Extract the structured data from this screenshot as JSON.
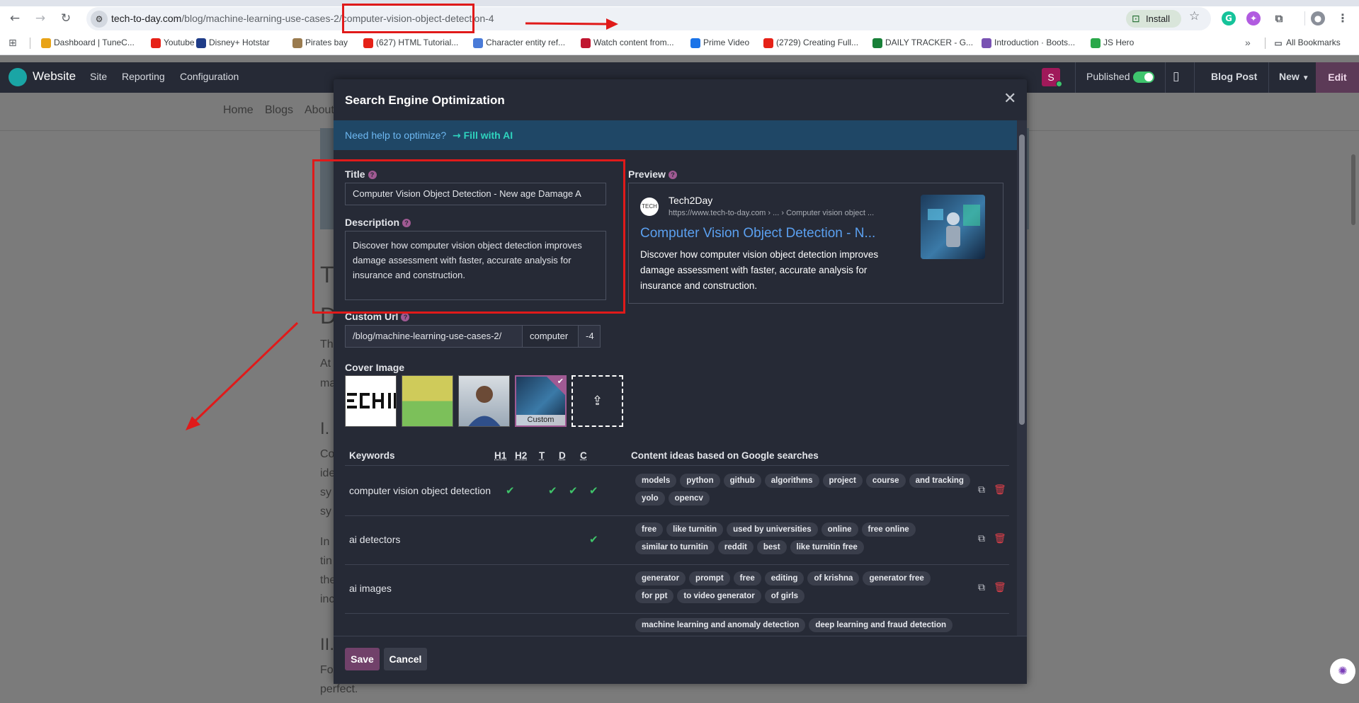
{
  "browser": {
    "url_domain": "tech-to-day.com",
    "url_path": "/blog/machine-learning-use-cases-2/computer-vision-object-detection-4",
    "install_label": "Install",
    "bookmarks": [
      {
        "label": "Dashboard | TuneC...",
        "color": "#e8a317"
      },
      {
        "label": "Youtube",
        "color": "#e62117"
      },
      {
        "label": "Disney+ Hotstar",
        "color": "#1f3c88"
      },
      {
        "label": "Pirates bay",
        "color": "#9a7b4f"
      },
      {
        "label": "(627) HTML Tutorial...",
        "color": "#e62117"
      },
      {
        "label": "Character entity ref...",
        "color": "#4a7bd8"
      },
      {
        "label": "Watch content from...",
        "color": "#c0152f"
      },
      {
        "label": "Prime Video",
        "color": "#1a73e8"
      },
      {
        "label": "(2729) Creating Full...",
        "color": "#e62117"
      },
      {
        "label": "DAILY TRACKER - G...",
        "color": "#188038"
      },
      {
        "label": "Introduction · Boots...",
        "color": "#7952b3"
      },
      {
        "label": "JS Hero",
        "color": "#2aa84a"
      }
    ],
    "all_bookmarks": "All Bookmarks"
  },
  "odoo": {
    "app": "Website",
    "menu": [
      "Site",
      "Reporting",
      "Configuration"
    ],
    "avatar_letter": "S",
    "published": "Published",
    "blog_post": "Blog Post",
    "new": "New",
    "edit": "Edit"
  },
  "page": {
    "nav": [
      "Home",
      "Blogs",
      "About"
    ],
    "text_t": "T",
    "text_d": "D",
    "p1": [
      "Th",
      "At",
      "ma"
    ],
    "h_i": "I.",
    "p2": [
      "Co",
      "ide",
      "sy",
      "sy"
    ],
    "p3": [
      "In",
      "tin",
      "the",
      "inc"
    ],
    "h_ii": "II.",
    "p4": [
      "Fo",
      "perfect."
    ]
  },
  "modal": {
    "title": "Search Engine Optimization",
    "help_text": "Need help to optimize?",
    "fill_ai": "Fill with AI",
    "title_label": "Title",
    "title_value": "Computer Vision Object Detection - New age Damage A",
    "description_label": "Description",
    "description_value": "Discover how computer vision object detection improves damage assessment with faster, accurate analysis for insurance and construction.",
    "custom_url_label": "Custom Url",
    "url_prefix": "/blog/machine-learning-use-cases-2/",
    "url_slug": "computer",
    "url_suffix": "-4",
    "cover_label": "Cover Image",
    "cover_custom": "Custom",
    "preview_label": "Preview",
    "preview": {
      "site": "Tech2Day",
      "url": "https://www.tech-to-day.com › ... › Computer vision object ...",
      "title": "Computer Vision Object Detection - N...",
      "desc": "Discover how computer vision object detection improves damage assessment with faster, accurate analysis for insurance and construction."
    },
    "kw_headers": {
      "keywords": "Keywords",
      "h1": "H1",
      "h2": "H2",
      "t": "T",
      "d": "D",
      "c": "C",
      "ideas": "Content ideas based on Google searches"
    },
    "keywords": [
      {
        "name": "computer vision object detection",
        "checks": {
          "h1": true,
          "h2": false,
          "t": true,
          "d": true,
          "c": true
        },
        "ideas": [
          "models",
          "python",
          "github",
          "algorithms",
          "project",
          "course",
          "and tracking",
          "yolo",
          "opencv"
        ]
      },
      {
        "name": "ai detectors",
        "checks": {
          "h1": false,
          "h2": false,
          "t": false,
          "d": false,
          "c": true
        },
        "ideas": [
          "free",
          "like turnitin",
          "used by universities",
          "online",
          "free online",
          "similar to turnitin",
          "reddit",
          "best",
          "like turnitin free"
        ]
      },
      {
        "name": "ai images",
        "checks": {
          "h1": false,
          "h2": false,
          "t": false,
          "d": false,
          "c": false
        },
        "ideas": [
          "generator",
          "prompt",
          "free",
          "editing",
          "of krishna",
          "generator free",
          "for ppt",
          "to video generator",
          "of girls"
        ]
      },
      {
        "name": "",
        "checks": {
          "h1": false,
          "h2": false,
          "t": false,
          "d": false,
          "c": false
        },
        "ideas": [
          "machine learning and anomaly detection",
          "deep learning and fraud detection"
        ]
      }
    ],
    "save": "Save",
    "cancel": "Cancel"
  },
  "colors": {
    "accent": "#71416a",
    "check": "#3fc46a",
    "link": "#5ba0f0",
    "annotation": "#e01a1a"
  },
  "icons": [
    "back-icon",
    "forward-icon",
    "reload-icon",
    "site-info-icon",
    "star-icon",
    "close-icon",
    "external-link-icon",
    "trash-icon",
    "upload-icon",
    "help-icon"
  ]
}
